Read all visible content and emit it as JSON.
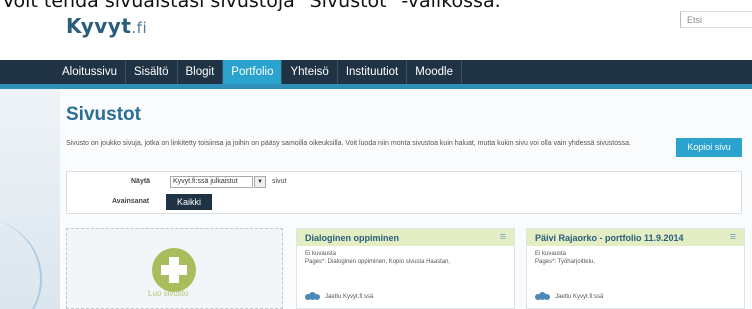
{
  "caption": "Voit tehdä sivuaistasi sivustoja \"Sivustot\" -valikossa.",
  "header": {
    "logo_main": "Kyvyt",
    "logo_suffix": ".fi",
    "search_placeholder": "Etsi"
  },
  "nav": {
    "items": [
      {
        "label": "Aloitussivu"
      },
      {
        "label": "Sisältö"
      },
      {
        "label": "Blogit"
      },
      {
        "label": "Portfolio",
        "active": true
      },
      {
        "label": "Yhteisö"
      },
      {
        "label": "Instituutiot"
      },
      {
        "label": "Moodle"
      }
    ],
    "colors": {
      "bar": "#1f3345",
      "active": "#2aa3cf"
    }
  },
  "page": {
    "title": "Sivustot",
    "description": "Sivusto on joukko sivuja, jotka on linkitetty toisiinsa ja joihin on pääsy samoilla oikeuksilla. Voit luoda niin monta sivustoa kuin haluat, mutta kukin sivu voi olla vain yhdessä sivustossa.",
    "copy_button": "Kopioi sivu"
  },
  "filter": {
    "show_label": "Näytä",
    "show_value": "Kyvyt.fi:ssä julkaistut",
    "suffix": "sivut",
    "keywords_label": "Avainsanat",
    "keywords_button": "Kaikki"
  },
  "create_tile": {
    "label": "Luo sivusto"
  },
  "cards": [
    {
      "title": "Dialoginen oppiminen",
      "description": "Ei kuvausta",
      "pages": "Pages*: Dialoginen oppiminen, Kopio sivusta Haastan,",
      "share": "Jaettu Kyvyt.fi:ssä"
    },
    {
      "title": "Päivi Rajaorko - portfolio 11.9.2014",
      "description": "Ei kuvausta",
      "pages": "Pages*: Työharjoittelu,",
      "share": "Jaettu Kyvyt.fi:ssä"
    }
  ]
}
